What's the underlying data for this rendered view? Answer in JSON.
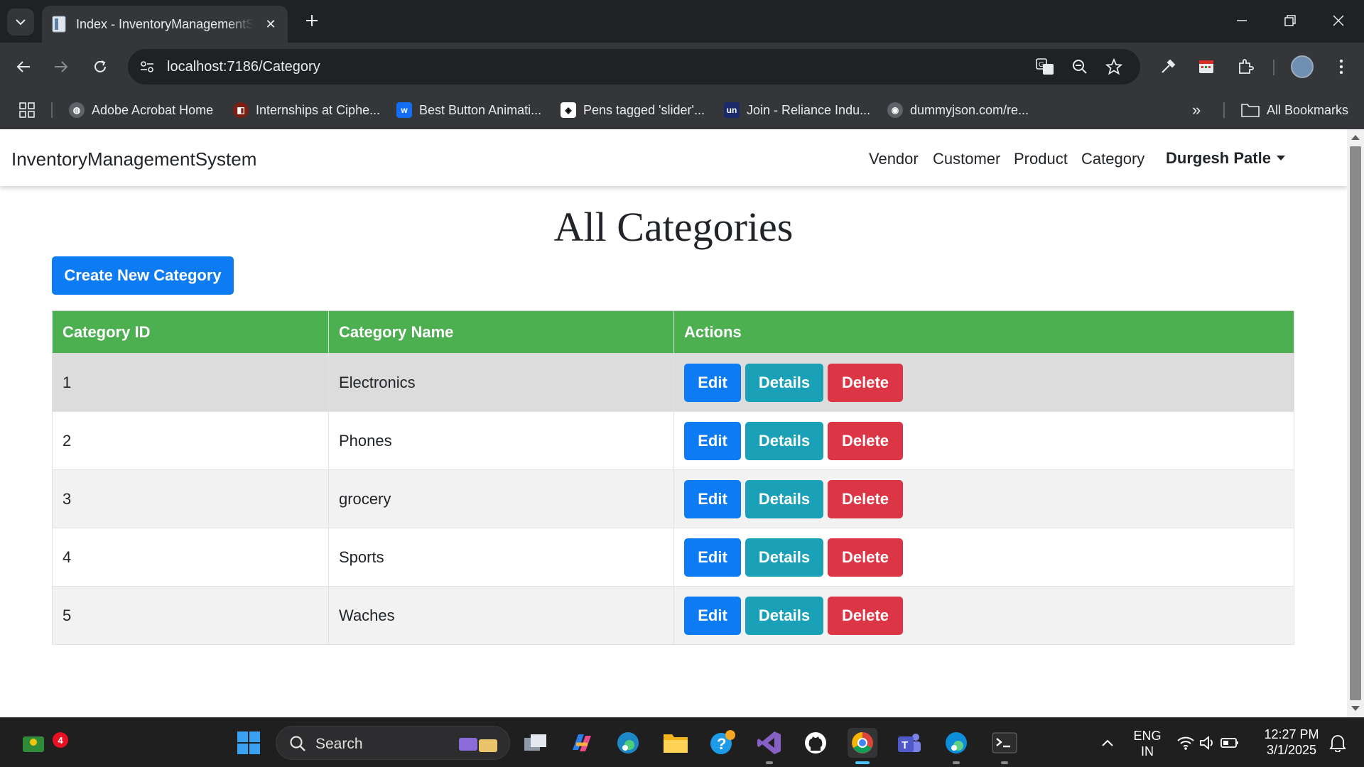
{
  "browser": {
    "tab_title": "Index - InventoryManagementSystem",
    "url": "localhost:7186/Category",
    "bookmarks": [
      {
        "label": "Adobe Acrobat Home"
      },
      {
        "label": "Internships at Ciphe..."
      },
      {
        "label": "Best Button Animati..."
      },
      {
        "label": "Pens tagged 'slider'..."
      },
      {
        "label": "Join - Reliance Indu..."
      },
      {
        "label": "dummyjson.com/re..."
      }
    ],
    "all_bookmarks_label": "All Bookmarks",
    "overflow_label": "»"
  },
  "navbar": {
    "brand": "InventoryManagementSystem",
    "links": [
      "Vendor",
      "Customer",
      "Product",
      "Category"
    ],
    "user": "Durgesh Patle"
  },
  "page": {
    "title": "All Categories",
    "create_button": "Create New Category",
    "columns": [
      "Category ID",
      "Category Name",
      "Actions"
    ],
    "rows": [
      {
        "id": "1",
        "name": "Electronics"
      },
      {
        "id": "2",
        "name": "Phones"
      },
      {
        "id": "3",
        "name": "grocery"
      },
      {
        "id": "4",
        "name": "Sports"
      },
      {
        "id": "5",
        "name": "Waches"
      }
    ],
    "actions": {
      "edit": "Edit",
      "details": "Details",
      "delete": "Delete"
    }
  },
  "taskbar": {
    "search_label": "Search",
    "notification_count": "4",
    "language": "ENG",
    "region": "IN",
    "time": "12:27 PM",
    "date": "3/1/2025"
  },
  "colors": {
    "table_header": "#4caf50",
    "primary": "#0d7bf3",
    "info": "#1aa1b8",
    "danger": "#dc3545"
  }
}
